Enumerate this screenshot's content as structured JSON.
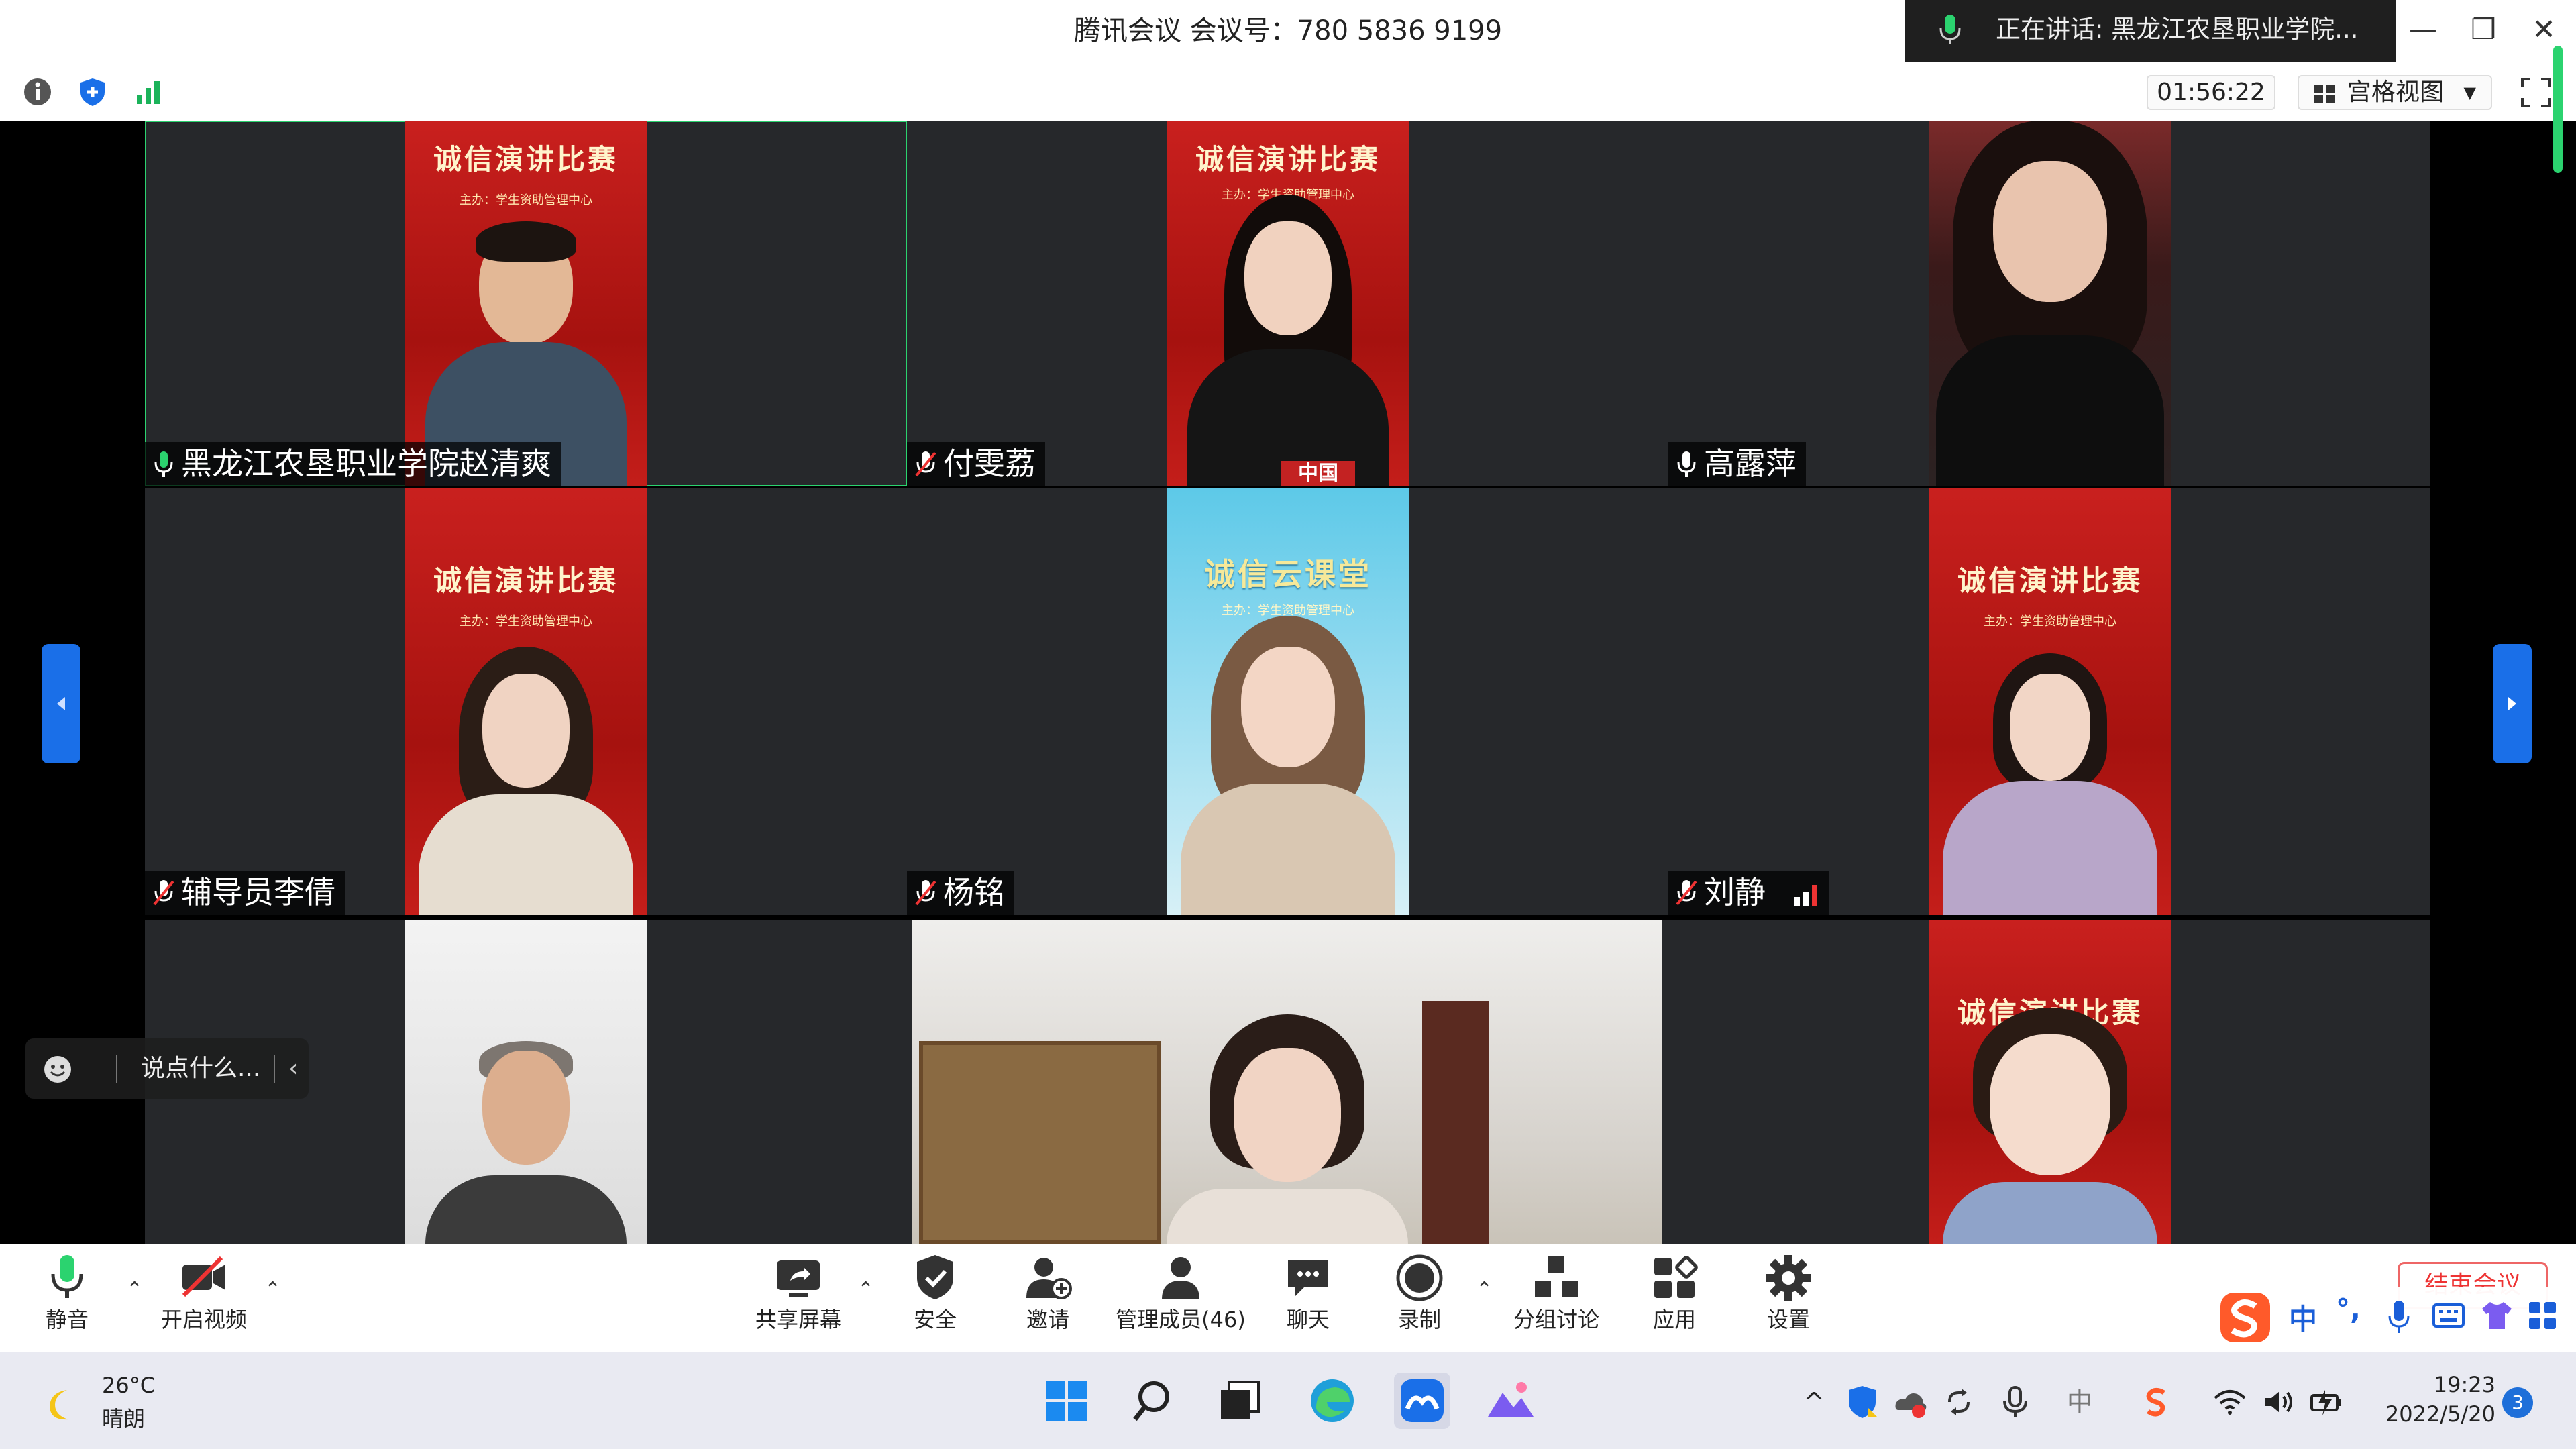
{
  "titlebar": {
    "title": "腾讯会议 会议号：780 5836 9199",
    "speaking": "正在讲话: 黑龙江农垦职业学院...",
    "minimize": "—",
    "restore": "❐",
    "close": "✕"
  },
  "subbar": {
    "timer": "01:56:22",
    "view_label": "宫格视图"
  },
  "tiles": [
    {
      "name": "黑龙江农垦职业学院赵清爽",
      "banner": "诚信演讲比赛",
      "sub": "主办：学生资助管理中心"
    },
    {
      "name": "付雯荔",
      "banner": "诚信演讲比赛",
      "sub": "主办：学生资助管理中心",
      "badge": "中国"
    },
    {
      "name": "高露萍"
    },
    {
      "name": "辅导员李倩",
      "banner": "诚信演讲比赛",
      "sub": "主办：学生资助管理中心"
    },
    {
      "name": "杨铭",
      "banner": "诚信云课堂",
      "sub": "主办：学生资助管理中心"
    },
    {
      "name": "刘静",
      "banner": "诚信演讲比赛",
      "sub": "主办：学生资助管理中心"
    },
    {
      "name": ""
    },
    {
      "name": ""
    },
    {
      "name": "",
      "banner": "诚信演讲比赛"
    }
  ],
  "chat": {
    "placeholder": "说点什么...",
    "chevron": "‹"
  },
  "toolbar": {
    "mute": "静音",
    "video": "开启视频",
    "share": "共享屏幕",
    "security": "安全",
    "invite": "邀请",
    "members": "管理成员(46)",
    "chat": "聊天",
    "record": "录制",
    "breakout": "分组讨论",
    "apps": "应用",
    "settings": "设置",
    "end": "结束会议",
    "caret": "⌃"
  },
  "ime": {
    "lang": "中",
    "punct": "°,"
  },
  "taskbar": {
    "temp": "26°C",
    "condition": "晴朗",
    "time": "19:23",
    "date": "2022/5/20",
    "notifications": "3",
    "tray_lang": "中",
    "tray_up": "^"
  },
  "colors": {
    "accent": "#1a6fe8",
    "speaking_green": "#2bd36f",
    "banner_red": "#b5161a"
  }
}
